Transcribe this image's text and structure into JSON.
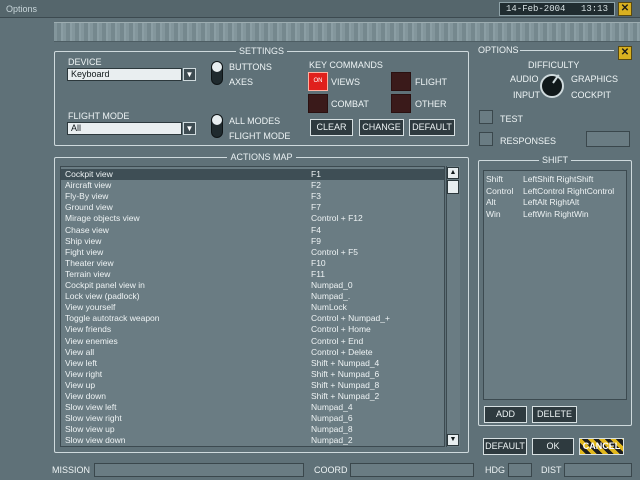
{
  "window": {
    "title": "Options",
    "date": "14-Feb-2004",
    "time": "13:13"
  },
  "settings": {
    "title": "SETTINGS",
    "device_label": "DEVICE",
    "device_value": "Keyboard",
    "flight_mode_label": "FLIGHT MODE",
    "flight_mode_value": "All",
    "toggle1": [
      "BUTTONS",
      "AXES"
    ],
    "toggle2": [
      "ALL MODES",
      "FLIGHT MODE"
    ],
    "key_commands": {
      "title": "KEY COMMANDS",
      "views_label": "VIEWS",
      "views_led_text": "ON",
      "flight_label": "FLIGHT",
      "combat_label": "COMBAT",
      "other_label": "OTHER"
    },
    "buttons": {
      "clear": "CLEAR",
      "change": "CHANGE",
      "default": "DEFAULT"
    }
  },
  "options": {
    "title": "OPTIONS",
    "difficulty": "DIFFICULTY",
    "audio": "AUDIO",
    "graphics": "GRAPHICS",
    "input": "INPUT",
    "cockpit": "COCKPIT",
    "test": "TEST",
    "responses": "RESPONSES"
  },
  "actions_map": {
    "title": "ACTIONS MAP",
    "rows": [
      {
        "action": "Cockpit view",
        "key": "F1"
      },
      {
        "action": "Aircraft view",
        "key": "F2"
      },
      {
        "action": "Fly-By view",
        "key": "F3"
      },
      {
        "action": "Ground view",
        "key": "F7"
      },
      {
        "action": "Mirage objects view",
        "key": "Control + F12"
      },
      {
        "action": "Chase view",
        "key": "F4"
      },
      {
        "action": "Ship view",
        "key": "F9"
      },
      {
        "action": "Fight view",
        "key": "Control + F5"
      },
      {
        "action": "Theater view",
        "key": "F10"
      },
      {
        "action": "Terrain view",
        "key": "F11"
      },
      {
        "action": "Cockpit panel view in",
        "key": "Numpad_0"
      },
      {
        "action": "Lock view (padlock)",
        "key": "Numpad_."
      },
      {
        "action": "View yourself",
        "key": "NumLock"
      },
      {
        "action": "Toggle autotrack weapon",
        "key": "Control + Numpad_+"
      },
      {
        "action": "View friends",
        "key": "Control + Home"
      },
      {
        "action": "View enemies",
        "key": "Control + End"
      },
      {
        "action": "View all",
        "key": "Control + Delete"
      },
      {
        "action": "View left",
        "key": "Shift + Numpad_4"
      },
      {
        "action": "View right",
        "key": "Shift + Numpad_6"
      },
      {
        "action": "View up",
        "key": "Shift + Numpad_8"
      },
      {
        "action": "View down",
        "key": "Shift + Numpad_2"
      },
      {
        "action": "Slow view left",
        "key": "Numpad_4"
      },
      {
        "action": "Slow view right",
        "key": "Numpad_6"
      },
      {
        "action": "Slow view up",
        "key": "Numpad_8"
      },
      {
        "action": "Slow view down",
        "key": "Numpad_2"
      }
    ]
  },
  "shift": {
    "title": "SHIFT",
    "rows": [
      {
        "mod": "Shift",
        "keys": "LeftShift RightShift"
      },
      {
        "mod": "Control",
        "keys": "LeftControl RightControl"
      },
      {
        "mod": "Alt",
        "keys": "LeftAlt RightAlt"
      },
      {
        "mod": "Win",
        "keys": "LeftWin RightWin"
      }
    ],
    "add": "ADD",
    "delete": "DELETE"
  },
  "footer_buttons": {
    "default": "DEFAULT",
    "ok": "OK",
    "cancel": "CANCEL"
  },
  "status": {
    "mission": "MISSION",
    "coord": "COORD",
    "hdg": "HDG",
    "dist": "DIST"
  },
  "icons": {
    "close": "close-icon",
    "scroll_up": "arrow-up-icon",
    "scroll_down": "arrow-down-icon",
    "dropdown": "chevron-down-icon"
  },
  "colors": {
    "background": "#5f7178",
    "led_on": "#e0201c",
    "cancel_stripe": "#e2b81c"
  }
}
